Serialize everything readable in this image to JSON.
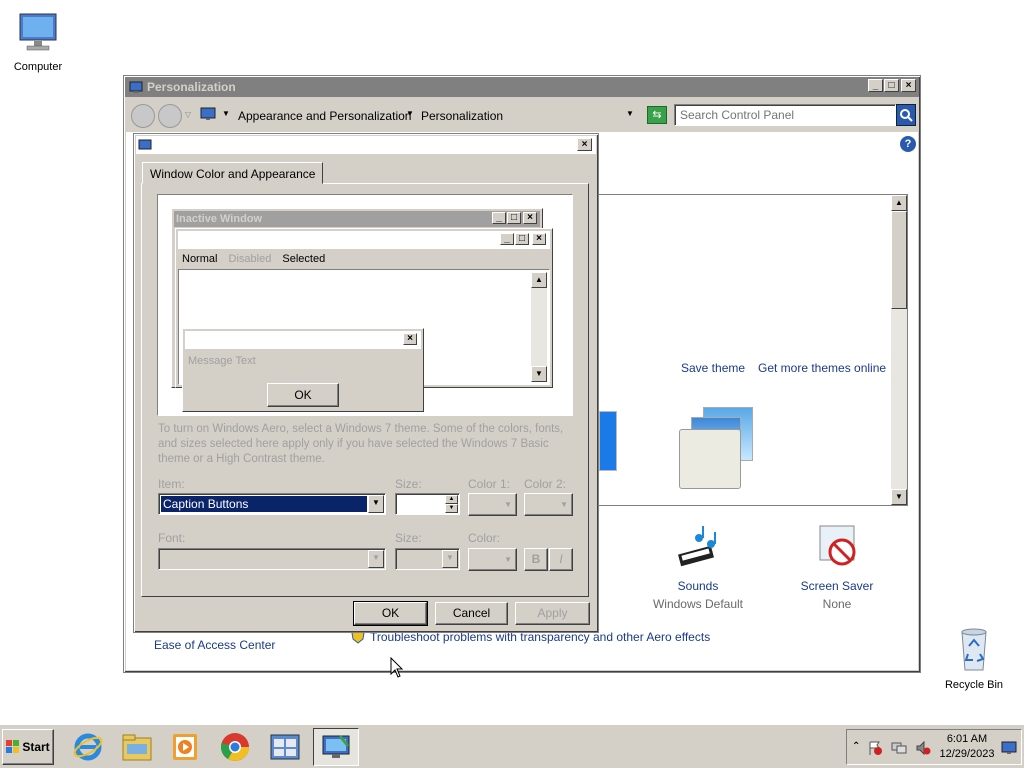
{
  "desktop": {
    "icons": [
      {
        "label": "Computer"
      },
      {
        "label": "Recycle Bin"
      }
    ]
  },
  "personalization": {
    "title": "Personalization",
    "breadcrumb": [
      "Appearance and Personalization",
      "Personalization"
    ],
    "search_placeholder": "Search Control Panel",
    "links": {
      "save_theme": "Save theme",
      "more_themes": "Get more themes online",
      "ease_of_access": "Ease of Access Center",
      "troubleshoot": "Troubleshoot problems with transparency and other Aero effects"
    },
    "sounds": {
      "label": "Sounds",
      "value": "Windows Default"
    },
    "screensaver": {
      "label": "Screen Saver",
      "value": "None"
    }
  },
  "dialog": {
    "tab": "Window Color and Appearance",
    "preview": {
      "inactive_title": "Inactive Window",
      "menu": [
        "Normal",
        "Disabled",
        "Selected"
      ],
      "message_text": "Message Text",
      "ok": "OK"
    },
    "info_text": "To turn on Windows Aero, select a Windows 7 theme.  Some of the colors, fonts, and sizes selected here apply only if you have selected the Windows 7 Basic theme or a High Contrast theme.",
    "labels": {
      "item": "Item:",
      "size": "Size:",
      "color1": "Color 1:",
      "color2": "Color 2:",
      "font": "Font:",
      "font_size": "Size:",
      "color": "Color:",
      "bold": "B",
      "italic": "I"
    },
    "item_value": "Caption Buttons",
    "buttons": {
      "ok": "OK",
      "cancel": "Cancel",
      "apply": "Apply"
    }
  },
  "taskbar": {
    "start": "Start",
    "time": "6:01 AM",
    "date": "12/29/2023"
  },
  "colors": {
    "selection": "#0a246a",
    "titlebar_inactive": "#808080",
    "face": "#d4d0c8",
    "link": "#1a3a8a"
  }
}
